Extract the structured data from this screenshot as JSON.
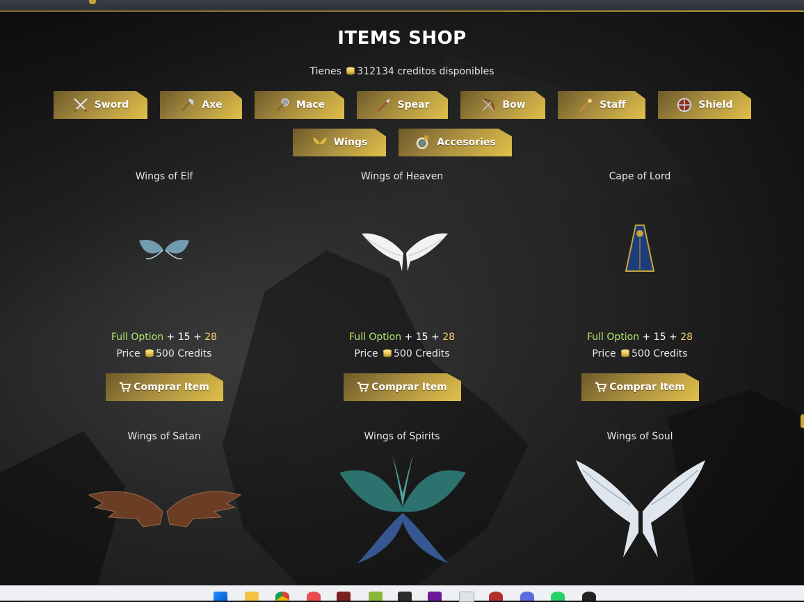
{
  "page": {
    "title": "ITEMS SHOP"
  },
  "credits": {
    "prefix": "Tienes",
    "amount": "312134",
    "suffix": "creditos disponibles"
  },
  "categories": [
    {
      "label": "Sword",
      "icon": "sword-icon"
    },
    {
      "label": "Axe",
      "icon": "axe-icon"
    },
    {
      "label": "Mace",
      "icon": "mace-icon"
    },
    {
      "label": "Spear",
      "icon": "spear-icon"
    },
    {
      "label": "Bow",
      "icon": "bow-icon"
    },
    {
      "label": "Staff",
      "icon": "staff-icon"
    },
    {
      "label": "Shield",
      "icon": "shield-icon"
    },
    {
      "label": "Wings",
      "icon": "wings-icon"
    },
    {
      "label": "Accesories",
      "icon": "accessories-icon"
    }
  ],
  "items": [
    {
      "name": "Wings of Elf",
      "image": "elf-wings-image",
      "option_label": "Full Option",
      "plus": "+",
      "level": "15",
      "plus2": "+",
      "extra": "28",
      "price_label": "Price",
      "price": "500 Credits",
      "buy_label": "Comprar Item"
    },
    {
      "name": "Wings of Heaven",
      "image": "heaven-wings-image",
      "option_label": "Full Option",
      "plus": "+",
      "level": "15",
      "plus2": "+",
      "extra": "28",
      "price_label": "Price",
      "price": "500 Credits",
      "buy_label": "Comprar Item"
    },
    {
      "name": "Cape of Lord",
      "image": "lord-cape-image",
      "option_label": "Full Option",
      "plus": "+",
      "level": "15",
      "plus2": "+",
      "extra": "28",
      "price_label": "Price",
      "price": "500 Credits",
      "buy_label": "Comprar Item"
    },
    {
      "name": "Wings of Satan",
      "image": "satan-wings-image"
    },
    {
      "name": "Wings of Spirits",
      "image": "spirit-wings-image"
    },
    {
      "name": "Wings of Soul",
      "image": "soul-wings-image"
    }
  ],
  "taskbar": {
    "icons": [
      "windows-start-icon",
      "file-explorer-icon",
      "chrome-icon",
      "app-icon",
      "game-icon",
      "files-icon",
      "terminal-icon",
      "editor-icon",
      "notepad-icon",
      "game2-icon",
      "chat-icon",
      "whatsapp-icon",
      "obs-icon"
    ]
  }
}
